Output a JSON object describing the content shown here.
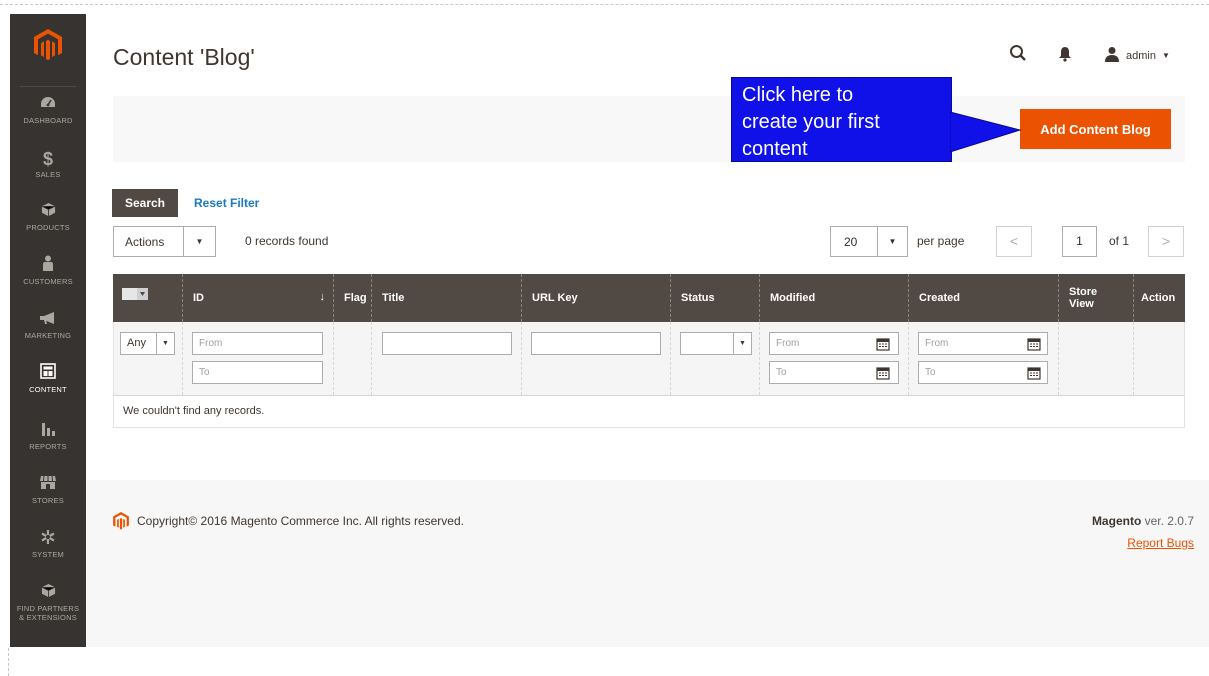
{
  "page": {
    "title": "Content 'Blog'"
  },
  "header": {
    "username": "admin"
  },
  "sidebar": {
    "items": [
      {
        "label": "DASHBOARD",
        "icon": "dashboard-icon"
      },
      {
        "label": "SALES",
        "icon": "dollar-icon"
      },
      {
        "label": "PRODUCTS",
        "icon": "cube-icon"
      },
      {
        "label": "CUSTOMERS",
        "icon": "person-icon"
      },
      {
        "label": "MARKETING",
        "icon": "megaphone-icon"
      },
      {
        "label": "CONTENT",
        "icon": "layout-icon"
      },
      {
        "label": "REPORTS",
        "icon": "bar-chart-icon"
      },
      {
        "label": "STORES",
        "icon": "store-icon"
      },
      {
        "label": "SYSTEM",
        "icon": "gear-icon"
      },
      {
        "label": "FIND PARTNERS & EXTENSIONS",
        "label_line1": "FIND PARTNERS",
        "label_line2": "& EXTENSIONS",
        "icon": "cube-icon"
      }
    ],
    "active_item": "CONTENT"
  },
  "actions": {
    "add_button": "Add Content Blog"
  },
  "callout": {
    "line1": "Click here to",
    "line2": "create your first",
    "line3": "content",
    "color": "#1010e8"
  },
  "toolbar": {
    "search_button": "Search",
    "reset_filter": "Reset Filter",
    "actions_select": "Actions",
    "records_found": "0 records found",
    "per_page_value": "20",
    "per_page_label": "per page",
    "page_current": "1",
    "page_of": "of 1"
  },
  "grid": {
    "columns": [
      "ID",
      "Flag",
      "Title",
      "URL Key",
      "Status",
      "Modified",
      "Created",
      "Store View",
      "Action"
    ],
    "store_view_line1": "Store",
    "store_view_line2": "View",
    "filters": {
      "any_select": "Any",
      "from_placeholder": "From",
      "to_placeholder": "To"
    },
    "empty_message": "We couldn't find any records."
  },
  "footer": {
    "copyright": "Copyright© 2016 Magento Commerce Inc. All rights reserved.",
    "brand": "Magento",
    "version": "ver. 2.0.7",
    "report_bugs": "Report Bugs"
  },
  "colors": {
    "accent": "#eb5202",
    "sidebar": "#373330",
    "grid_header": "#514943",
    "link": "#1979c3"
  }
}
